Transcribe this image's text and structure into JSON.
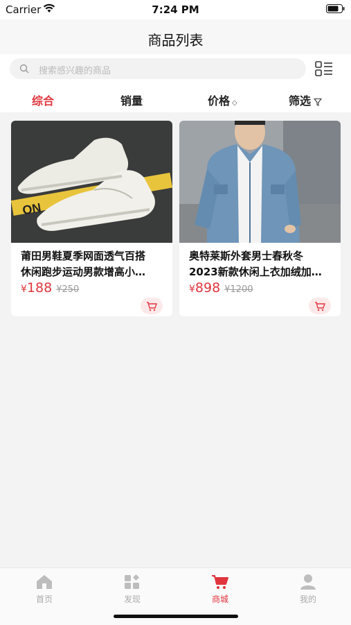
{
  "status": {
    "carrier": "Carrier",
    "time": "7:24 PM"
  },
  "navbar": {
    "title": "商品列表"
  },
  "search": {
    "placeholder": "搜索感兴趣的商品"
  },
  "sort": {
    "comprehensive": "综合",
    "sales": "销量",
    "price": "价格",
    "filter": "筛选"
  },
  "products": [
    {
      "name_line1": "莆田男鞋夏季网面透气百搭",
      "name_line2": "休闲跑步运动男款增高小…",
      "currency": "¥",
      "price": "188",
      "original_price": "¥250"
    },
    {
      "name_line1": "奥特莱斯外套男士春秋冬",
      "name_line2": "2023新款休闲上衣加绒加…",
      "currency": "¥",
      "price": "898",
      "original_price": "¥1200"
    }
  ],
  "tabbar": {
    "home": "首页",
    "discover": "发现",
    "mall": "商城",
    "mine": "我的"
  },
  "colors": {
    "accent": "#e0353d"
  }
}
